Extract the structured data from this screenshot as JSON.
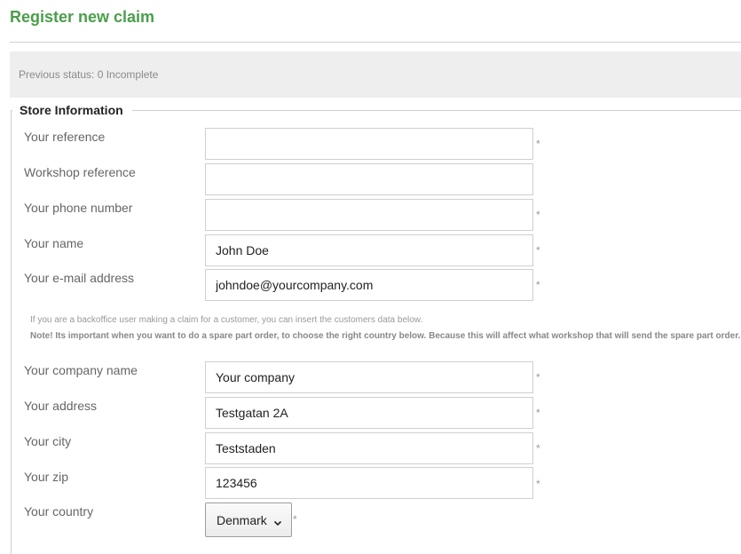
{
  "page": {
    "title": "Register new claim"
  },
  "status": {
    "text": "Previous status: 0 Incomplete"
  },
  "store_section": {
    "legend": "Store Information"
  },
  "required_mark": "*",
  "fields": {
    "your_reference": {
      "label": "Your reference",
      "value": ""
    },
    "workshop_reference": {
      "label": "Workshop reference",
      "value": ""
    },
    "phone_number": {
      "label": "Your phone number",
      "value": ""
    },
    "name": {
      "label": "Your name",
      "value": "John Doe"
    },
    "email": {
      "label": "Your e-mail address",
      "value": "johndoe@yourcompany.com"
    },
    "company_name": {
      "label": "Your company name",
      "value": "Your company"
    },
    "address": {
      "label": "Your address",
      "value": "Testgatan 2A"
    },
    "city": {
      "label": "Your city",
      "value": "Teststaden"
    },
    "zip": {
      "label": "Your zip",
      "value": "123456"
    },
    "country": {
      "label": "Your country",
      "value": "Denmark"
    }
  },
  "notes": {
    "backoffice": "If you are a backoffice user making a claim for a customer, you can insert the customers data below.",
    "country_warning": "Note! Its important when you want to do a spare part order, to choose the right country below. Because this will affect what workshop that will send the spare part order."
  },
  "icons": {
    "country_dropdown": "chevron-down-icon"
  }
}
